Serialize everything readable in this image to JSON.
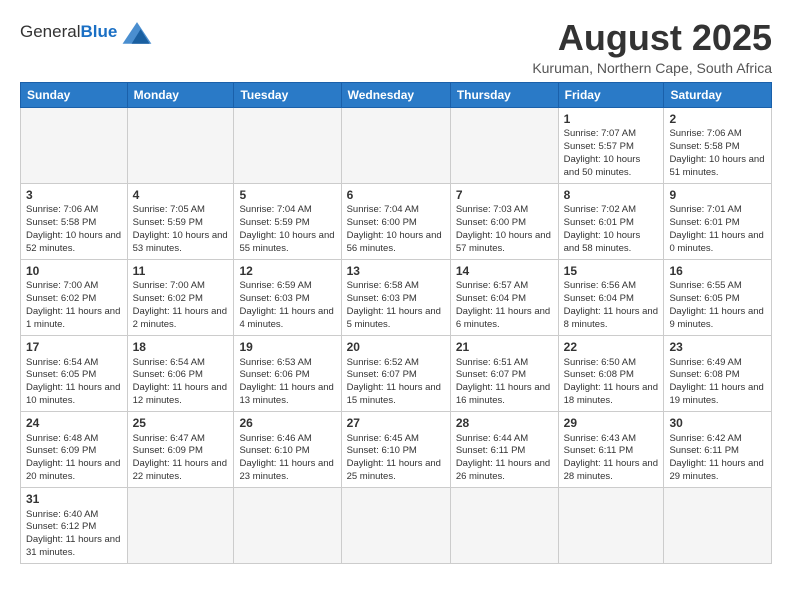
{
  "logo": {
    "text_general": "General",
    "text_blue": "Blue"
  },
  "title": "August 2025",
  "subtitle": "Kuruman, Northern Cape, South Africa",
  "weekdays": [
    "Sunday",
    "Monday",
    "Tuesday",
    "Wednesday",
    "Thursday",
    "Friday",
    "Saturday"
  ],
  "weeks": [
    [
      {
        "day": "",
        "info": ""
      },
      {
        "day": "",
        "info": ""
      },
      {
        "day": "",
        "info": ""
      },
      {
        "day": "",
        "info": ""
      },
      {
        "day": "",
        "info": ""
      },
      {
        "day": "1",
        "info": "Sunrise: 7:07 AM\nSunset: 5:57 PM\nDaylight: 10 hours\nand 50 minutes."
      },
      {
        "day": "2",
        "info": "Sunrise: 7:06 AM\nSunset: 5:58 PM\nDaylight: 10 hours\nand 51 minutes."
      }
    ],
    [
      {
        "day": "3",
        "info": "Sunrise: 7:06 AM\nSunset: 5:58 PM\nDaylight: 10 hours\nand 52 minutes."
      },
      {
        "day": "4",
        "info": "Sunrise: 7:05 AM\nSunset: 5:59 PM\nDaylight: 10 hours\nand 53 minutes."
      },
      {
        "day": "5",
        "info": "Sunrise: 7:04 AM\nSunset: 5:59 PM\nDaylight: 10 hours\nand 55 minutes."
      },
      {
        "day": "6",
        "info": "Sunrise: 7:04 AM\nSunset: 6:00 PM\nDaylight: 10 hours\nand 56 minutes."
      },
      {
        "day": "7",
        "info": "Sunrise: 7:03 AM\nSunset: 6:00 PM\nDaylight: 10 hours\nand 57 minutes."
      },
      {
        "day": "8",
        "info": "Sunrise: 7:02 AM\nSunset: 6:01 PM\nDaylight: 10 hours\nand 58 minutes."
      },
      {
        "day": "9",
        "info": "Sunrise: 7:01 AM\nSunset: 6:01 PM\nDaylight: 11 hours\nand 0 minutes."
      }
    ],
    [
      {
        "day": "10",
        "info": "Sunrise: 7:00 AM\nSunset: 6:02 PM\nDaylight: 11 hours\nand 1 minute."
      },
      {
        "day": "11",
        "info": "Sunrise: 7:00 AM\nSunset: 6:02 PM\nDaylight: 11 hours\nand 2 minutes."
      },
      {
        "day": "12",
        "info": "Sunrise: 6:59 AM\nSunset: 6:03 PM\nDaylight: 11 hours\nand 4 minutes."
      },
      {
        "day": "13",
        "info": "Sunrise: 6:58 AM\nSunset: 6:03 PM\nDaylight: 11 hours\nand 5 minutes."
      },
      {
        "day": "14",
        "info": "Sunrise: 6:57 AM\nSunset: 6:04 PM\nDaylight: 11 hours\nand 6 minutes."
      },
      {
        "day": "15",
        "info": "Sunrise: 6:56 AM\nSunset: 6:04 PM\nDaylight: 11 hours\nand 8 minutes."
      },
      {
        "day": "16",
        "info": "Sunrise: 6:55 AM\nSunset: 6:05 PM\nDaylight: 11 hours\nand 9 minutes."
      }
    ],
    [
      {
        "day": "17",
        "info": "Sunrise: 6:54 AM\nSunset: 6:05 PM\nDaylight: 11 hours\nand 10 minutes."
      },
      {
        "day": "18",
        "info": "Sunrise: 6:54 AM\nSunset: 6:06 PM\nDaylight: 11 hours\nand 12 minutes."
      },
      {
        "day": "19",
        "info": "Sunrise: 6:53 AM\nSunset: 6:06 PM\nDaylight: 11 hours\nand 13 minutes."
      },
      {
        "day": "20",
        "info": "Sunrise: 6:52 AM\nSunset: 6:07 PM\nDaylight: 11 hours\nand 15 minutes."
      },
      {
        "day": "21",
        "info": "Sunrise: 6:51 AM\nSunset: 6:07 PM\nDaylight: 11 hours\nand 16 minutes."
      },
      {
        "day": "22",
        "info": "Sunrise: 6:50 AM\nSunset: 6:08 PM\nDaylight: 11 hours\nand 18 minutes."
      },
      {
        "day": "23",
        "info": "Sunrise: 6:49 AM\nSunset: 6:08 PM\nDaylight: 11 hours\nand 19 minutes."
      }
    ],
    [
      {
        "day": "24",
        "info": "Sunrise: 6:48 AM\nSunset: 6:09 PM\nDaylight: 11 hours\nand 20 minutes."
      },
      {
        "day": "25",
        "info": "Sunrise: 6:47 AM\nSunset: 6:09 PM\nDaylight: 11 hours\nand 22 minutes."
      },
      {
        "day": "26",
        "info": "Sunrise: 6:46 AM\nSunset: 6:10 PM\nDaylight: 11 hours\nand 23 minutes."
      },
      {
        "day": "27",
        "info": "Sunrise: 6:45 AM\nSunset: 6:10 PM\nDaylight: 11 hours\nand 25 minutes."
      },
      {
        "day": "28",
        "info": "Sunrise: 6:44 AM\nSunset: 6:11 PM\nDaylight: 11 hours\nand 26 minutes."
      },
      {
        "day": "29",
        "info": "Sunrise: 6:43 AM\nSunset: 6:11 PM\nDaylight: 11 hours\nand 28 minutes."
      },
      {
        "day": "30",
        "info": "Sunrise: 6:42 AM\nSunset: 6:11 PM\nDaylight: 11 hours\nand 29 minutes."
      }
    ],
    [
      {
        "day": "31",
        "info": "Sunrise: 6:40 AM\nSunset: 6:12 PM\nDaylight: 11 hours\nand 31 minutes."
      },
      {
        "day": "",
        "info": ""
      },
      {
        "day": "",
        "info": ""
      },
      {
        "day": "",
        "info": ""
      },
      {
        "day": "",
        "info": ""
      },
      {
        "day": "",
        "info": ""
      },
      {
        "day": "",
        "info": ""
      }
    ]
  ]
}
